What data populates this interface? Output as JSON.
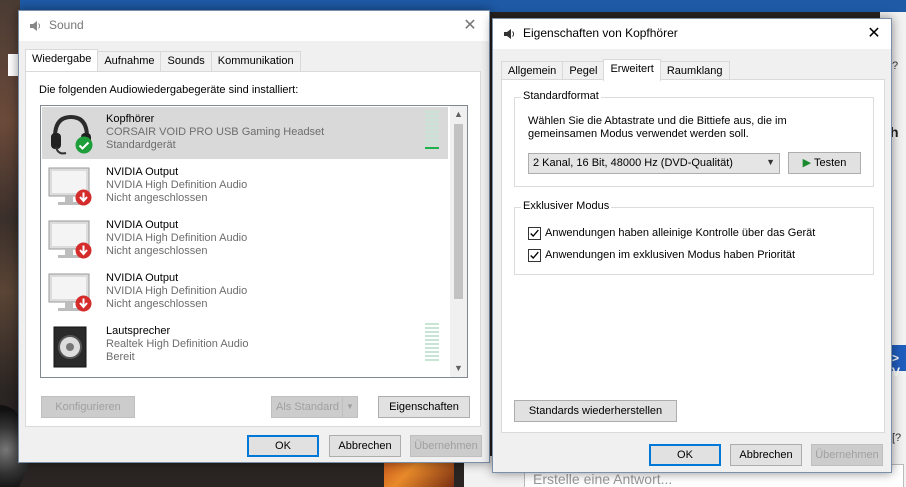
{
  "background": {
    "right_heading_fragment": "h",
    "right_button_fragment": "> V",
    "right_marker_top": "?",
    "right_marker_bottom": "[?",
    "reply_placeholder": "Erstelle eine Antwort..."
  },
  "sound_window": {
    "title": "Sound",
    "close_symbol": "✕",
    "tabs": [
      "Wiedergabe",
      "Aufnahme",
      "Sounds",
      "Kommunikation"
    ],
    "active_tab": "Wiedergabe",
    "list_heading": "Die folgenden Audiowiedergabegeräte sind installiert:",
    "devices": [
      {
        "name": "Kopfhörer",
        "description": "CORSAIR VOID PRO USB Gaming Headset",
        "status": "Standardgerät",
        "icon": "headset-icon",
        "badge": "default-check-badge",
        "selected": true,
        "level": 0.1
      },
      {
        "name": "NVIDIA Output",
        "description": "NVIDIA High Definition Audio",
        "status": "Nicht angeschlossen",
        "icon": "monitor-icon",
        "badge": "disconnected-arrow-badge",
        "selected": false
      },
      {
        "name": "NVIDIA Output",
        "description": "NVIDIA High Definition Audio",
        "status": "Nicht angeschlossen",
        "icon": "monitor-icon",
        "badge": "disconnected-arrow-badge",
        "selected": false
      },
      {
        "name": "NVIDIA Output",
        "description": "NVIDIA High Definition Audio",
        "status": "Nicht angeschlossen",
        "icon": "monitor-icon",
        "badge": "disconnected-arrow-badge",
        "selected": false
      },
      {
        "name": "Lautsprecher",
        "description": "Realtek High Definition Audio",
        "status": "Bereit",
        "icon": "speaker-icon",
        "badge": "",
        "selected": false,
        "level": 0
      }
    ],
    "buttons": {
      "configure": "Konfigurieren",
      "set_default": "Als Standard",
      "properties": "Eigenschaften",
      "ok": "OK",
      "cancel": "Abbrechen",
      "apply": "Übernehmen"
    }
  },
  "props_window": {
    "title": "Eigenschaften von Kopfhörer",
    "close_symbol": "✕",
    "tabs": [
      "Allgemein",
      "Pegel",
      "Erweitert",
      "Raumklang"
    ],
    "active_tab": "Erweitert",
    "default_format": {
      "group_label": "Standardformat",
      "description_line1": "Wählen Sie die Abtastrate und die Bittiefe aus, die im",
      "description_line2": "gemeinsamen Modus verwendet werden soll.",
      "selected_format": "2 Kanal, 16 Bit, 48000 Hz (DVD-Qualität)",
      "test_button": "Testen"
    },
    "exclusive_mode": {
      "group_label": "Exklusiver Modus",
      "option1": {
        "label": "Anwendungen haben alleinige Kontrolle über das Gerät",
        "checked": true
      },
      "option2": {
        "label": "Anwendungen im exklusiven Modus haben Priorität",
        "checked": true
      }
    },
    "buttons": {
      "restore_defaults": "Standards wiederherstellen",
      "ok": "OK",
      "cancel": "Abbrechen",
      "apply": "Übernehmen"
    }
  }
}
